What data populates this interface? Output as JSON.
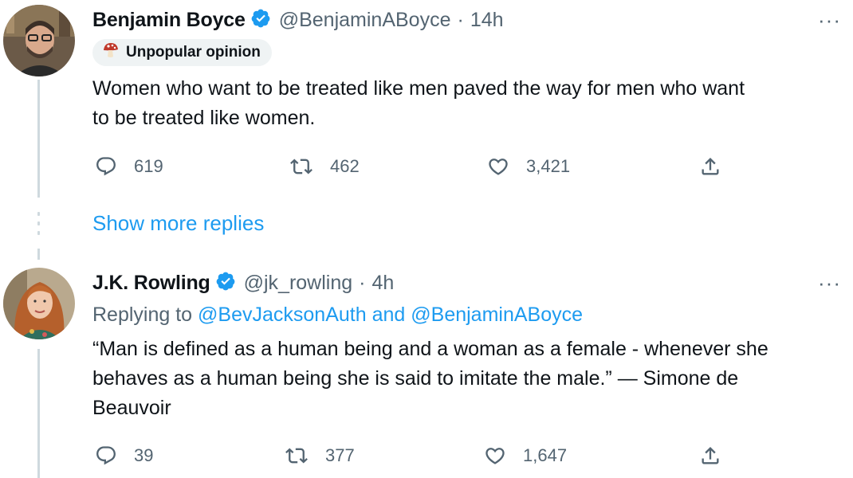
{
  "tweet1": {
    "name": "Benjamin Boyce",
    "handle": "@BenjaminABoyce",
    "time": "14h",
    "badge": "Unpopular opinion",
    "badge_icon": "mushroom-icon",
    "text_line1": "Women who want to be treated like men paved the way for men who want",
    "text_line2": "to be treated like women.",
    "replies": "619",
    "retweets": "462",
    "likes": "3,421"
  },
  "show_more": "Show more replies",
  "tweet2": {
    "name": "J.K. Rowling",
    "handle": "@jk_rowling",
    "time": "4h",
    "replying_prefix": "Replying to",
    "reply_user1": "@BevJacksonAuth",
    "reply_and": "and",
    "reply_user2": "@BenjaminABoyce",
    "text_line1": "“Man is defined as a human being and a woman as a female - whenever she",
    "text_line2": "behaves as a human being she is said to imitate the male.” — Simone de",
    "text_line3": "Beauvoir",
    "replies": "39",
    "retweets": "377",
    "likes": "1,647"
  },
  "separator": "·",
  "more_glyph": "···",
  "colors": {
    "accent": "#1d9bf0",
    "secondary_text": "#536471",
    "thread_line": "#cfd9de"
  }
}
